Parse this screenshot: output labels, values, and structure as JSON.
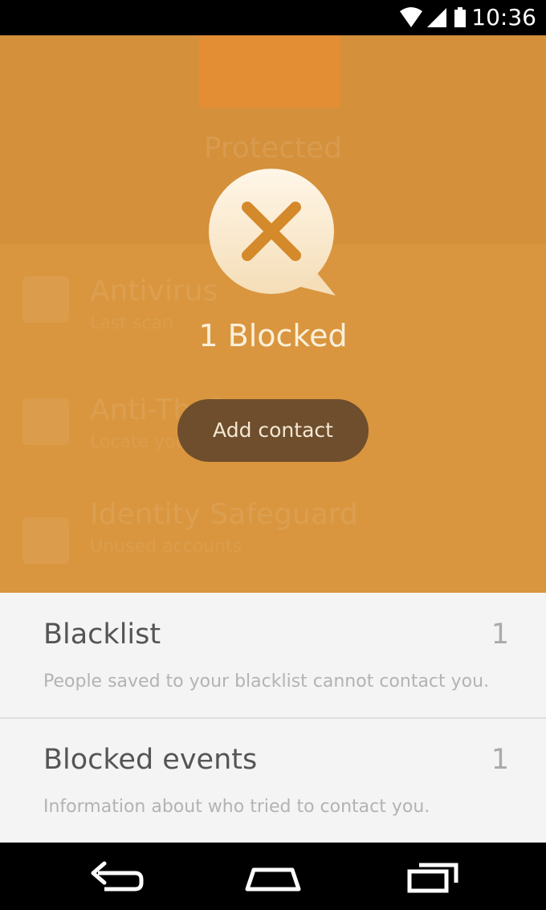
{
  "status_bar": {
    "time": "10:36",
    "icons": [
      "wifi-icon",
      "signal-icon",
      "battery-icon"
    ]
  },
  "background": {
    "status_text": "Protected",
    "features": [
      {
        "title": "Antivirus",
        "subtitle": "Last scan",
        "icon": "antivirus-icon"
      },
      {
        "title": "Anti-Theft",
        "subtitle": "Locate your device",
        "icon": "location-pin-icon"
      },
      {
        "title": "Identity Safeguard",
        "subtitle": "Unused accounts",
        "icon": "info-icon"
      }
    ]
  },
  "overlay": {
    "blocked_label": "1 Blocked",
    "add_contact_label": "Add contact",
    "icon": "close-icon"
  },
  "sheet": {
    "rows": [
      {
        "title": "Blacklist",
        "count": "1",
        "description": "People saved to your blacklist cannot contact you."
      },
      {
        "title": "Blocked events",
        "count": "1",
        "description": "Information about who tried to contact you."
      }
    ]
  },
  "nav_bar": {
    "buttons": [
      "back-icon",
      "home-icon",
      "recents-icon"
    ]
  },
  "colors": {
    "accent": "#d9963f",
    "button": "#6e4e2c",
    "sheet": "#f4f4f4"
  }
}
